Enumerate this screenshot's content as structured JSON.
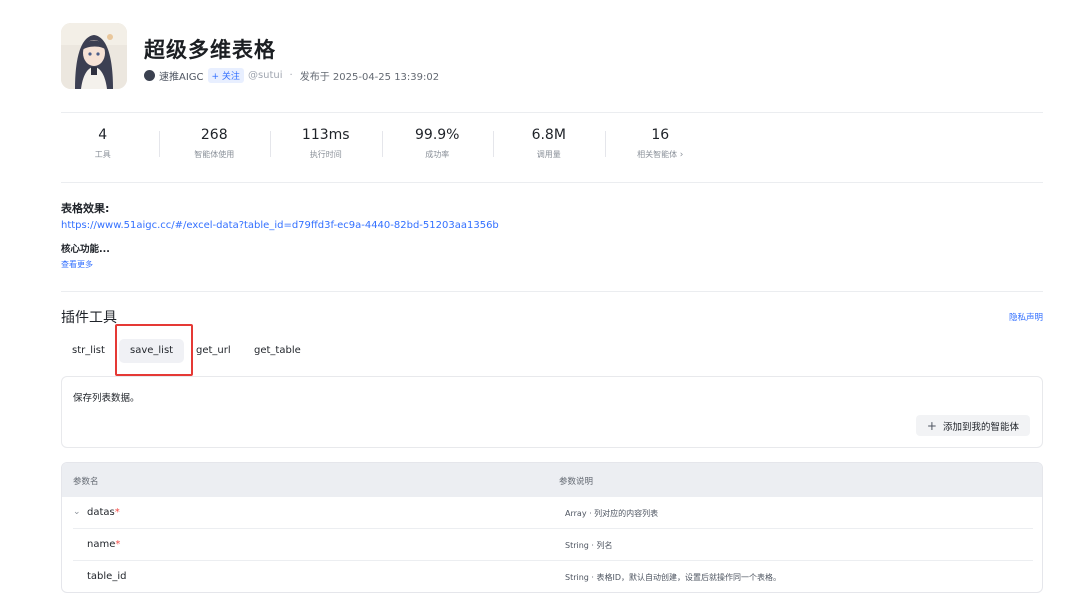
{
  "header": {
    "title": "超级多维表格",
    "author": "速推AIGC",
    "follow_label": "+ 关注",
    "handle": "@sutui",
    "published": "发布于 2025-04-25 13:39:02"
  },
  "stats": [
    {
      "value": "4",
      "label": "工具"
    },
    {
      "value": "268",
      "label": "智能体使用"
    },
    {
      "value": "113ms",
      "label": "执行时间"
    },
    {
      "value": "99.9%",
      "label": "成功率"
    },
    {
      "value": "6.8M",
      "label": "调用量"
    },
    {
      "value": "16",
      "label": "相关智能体"
    }
  ],
  "description": {
    "heading": "表格效果:",
    "link": "https://www.51aigc.cc/#/excel-data?table_id=d79ffd3f-ec9a-4440-82bd-51203aa1356b",
    "core": "核心功能...",
    "more": "查看更多"
  },
  "tools": {
    "section_title": "插件工具",
    "privacy": "隐私声明",
    "tabs": [
      "str_list",
      "save_list",
      "get_url",
      "get_table"
    ],
    "active_tab": "save_list",
    "card_text": "保存列表数据。",
    "add_button": "添加到我的智能体"
  },
  "params": {
    "col_name": "参数名",
    "col_desc": "参数说明",
    "rows": [
      {
        "name": "datas",
        "required": true,
        "desc": "Array · 列对应的内容列表"
      },
      {
        "name": "name",
        "required": true,
        "desc": "String · 列名"
      },
      {
        "name": "table_id",
        "required": false,
        "desc": "String · 表格ID，默认自动创建，设置后就操作同一个表格。"
      }
    ]
  }
}
